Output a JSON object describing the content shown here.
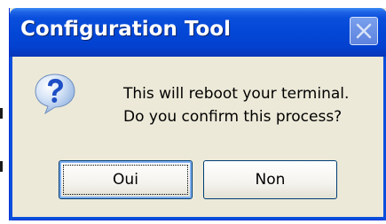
{
  "dialog": {
    "title": "Configuration Tool",
    "icon": "question-icon",
    "message_lines": [
      "This will reboot your terminal.",
      "Do you confirm this process?"
    ],
    "buttons": {
      "yes_label": "Oui",
      "no_label": "Non"
    },
    "colors": {
      "titlebar": "#0347d6",
      "body": "#ece9d8",
      "button_border": "#003c74"
    }
  }
}
